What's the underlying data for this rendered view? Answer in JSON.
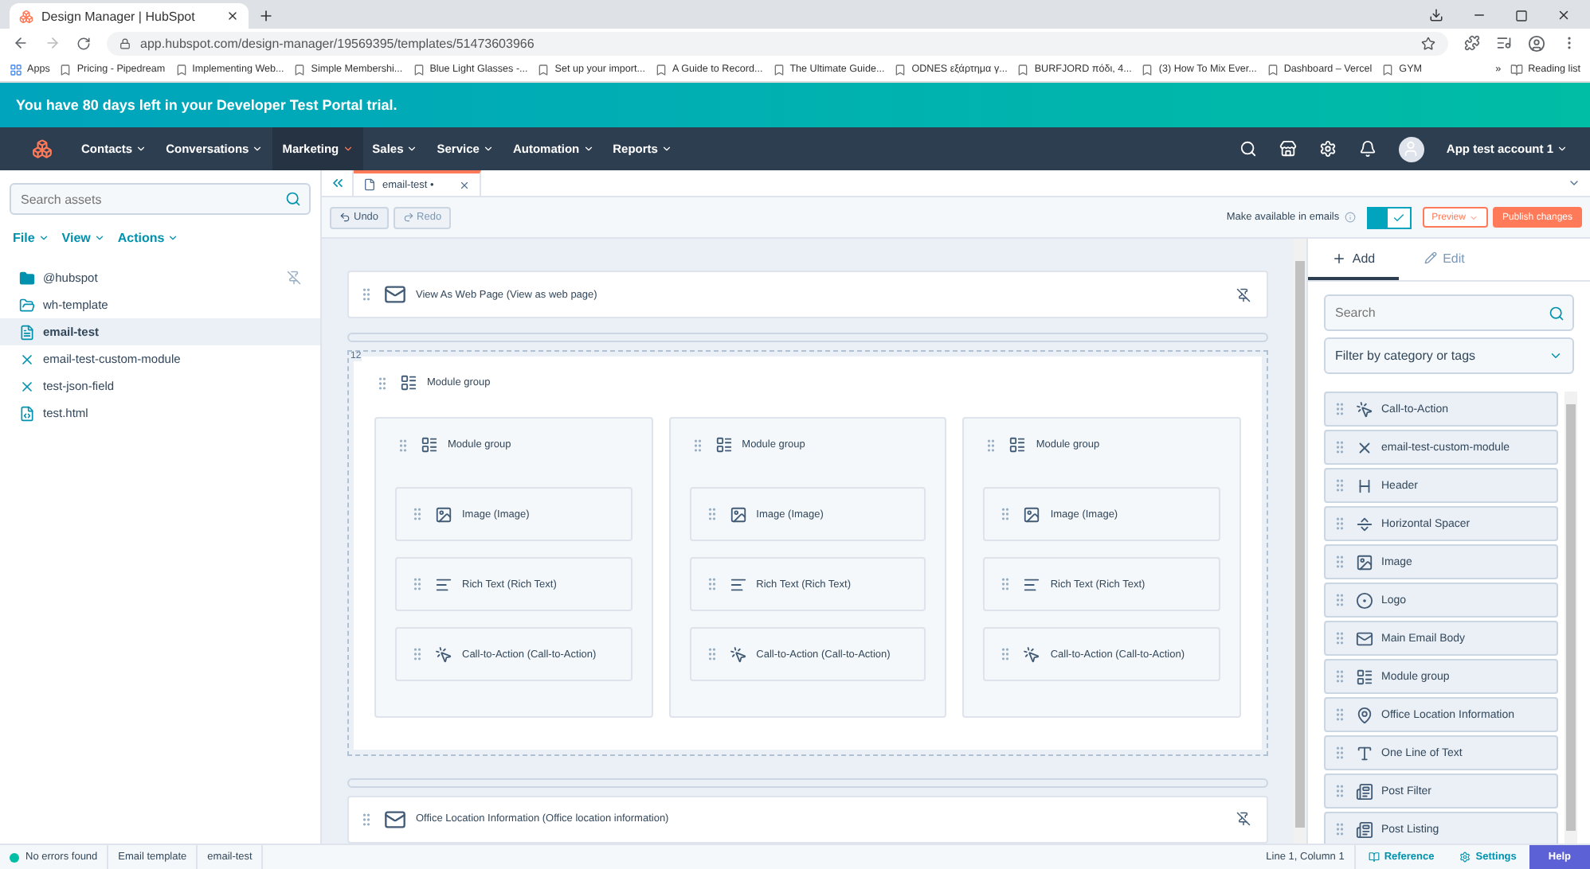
{
  "browser": {
    "tab_title": "Design Manager | HubSpot",
    "url": "app.hubspot.com/design-manager/19569395/templates/51473603966",
    "bookmarks": [
      "Apps",
      "Pricing - Pipedream",
      "Implementing Web...",
      "Simple Membershi...",
      "Blue Light Glasses -...",
      "Set up your import...",
      "A Guide to Record...",
      "The Ultimate Guide...",
      "ODNES εξάρτημα γ...",
      "BURFJORD πόδι, 4...",
      "(3) How To Mix Ever...",
      "Dashboard – Vercel",
      "GYM"
    ],
    "bookmarks_more": "»",
    "reading_list": "Reading list"
  },
  "banner": "You have 80 days left in your Developer Test Portal trial.",
  "nav": {
    "items": [
      {
        "label": "Contacts",
        "selected": false
      },
      {
        "label": "Conversations",
        "selected": false
      },
      {
        "label": "Marketing",
        "selected": true
      },
      {
        "label": "Sales",
        "selected": false
      },
      {
        "label": "Service",
        "selected": false
      },
      {
        "label": "Automation",
        "selected": false
      },
      {
        "label": "Reports",
        "selected": false
      }
    ],
    "account": "App test account 1"
  },
  "sidebar": {
    "search": {
      "placeholder": "Search assets"
    },
    "menus": [
      "File",
      "View",
      "Actions"
    ],
    "items": [
      {
        "kind": "folder",
        "label": "@hubspot",
        "selected": false,
        "pinned": true
      },
      {
        "kind": "template_folder",
        "label": "wh-template",
        "selected": false,
        "pinned": false
      },
      {
        "kind": "template",
        "label": "email-test",
        "selected": true,
        "pinned": false
      },
      {
        "kind": "module",
        "label": "email-test-custom-module",
        "selected": false,
        "pinned": false
      },
      {
        "kind": "module",
        "label": "test-json-field",
        "selected": false,
        "pinned": false
      },
      {
        "kind": "html",
        "label": "test.html",
        "selected": false,
        "pinned": false
      }
    ]
  },
  "editor_tab": {
    "label": "email-test",
    "unsaved_mark": "•"
  },
  "toolbar": {
    "undo": {
      "label": "Undo",
      "disabled": false
    },
    "redo": {
      "label": "Redo",
      "disabled": true
    },
    "available_label": "Make available in emails",
    "available_on": true,
    "preview": "Preview",
    "publish": "Publish changes"
  },
  "canvas": {
    "sections": [
      {
        "kind": "module",
        "label": "View As Web Page (View as web page)"
      },
      {
        "kind": "group",
        "number": "12",
        "label": "Module group",
        "columns": [
          {
            "label": "Module group",
            "modules": [
              {
                "kind": "image",
                "label": "Image (Image)"
              },
              {
                "kind": "rich_text",
                "label": "Rich Text (Rich Text)"
              },
              {
                "kind": "cta",
                "label": "Call-to-Action (Call-to-Action)"
              }
            ]
          },
          {
            "label": "Module group",
            "modules": [
              {
                "kind": "image",
                "label": "Image (Image)"
              },
              {
                "kind": "rich_text",
                "label": "Rich Text (Rich Text)"
              },
              {
                "kind": "cta",
                "label": "Call-to-Action (Call-to-Action)"
              }
            ]
          },
          {
            "label": "Module group",
            "modules": [
              {
                "kind": "image",
                "label": "Image (Image)"
              },
              {
                "kind": "rich_text",
                "label": "Rich Text (Rich Text)"
              },
              {
                "kind": "cta",
                "label": "Call-to-Action (Call-to-Action)"
              }
            ]
          }
        ]
      },
      {
        "kind": "module",
        "label": "Office Location Information (Office location information)"
      }
    ]
  },
  "panel": {
    "tabs": [
      {
        "label": "Add",
        "selected": true
      },
      {
        "label": "Edit",
        "selected": false
      }
    ],
    "search": {
      "placeholder": "Search"
    },
    "filter": "Filter by category or tags",
    "modules": [
      {
        "kind": "cta",
        "label": "Call-to-Action"
      },
      {
        "kind": "custom",
        "label": "email-test-custom-module"
      },
      {
        "kind": "header",
        "label": "Header"
      },
      {
        "kind": "spacer",
        "label": "Horizontal Spacer"
      },
      {
        "kind": "image",
        "label": "Image"
      },
      {
        "kind": "logo",
        "label": "Logo"
      },
      {
        "kind": "body",
        "label": "Main Email Body"
      },
      {
        "kind": "group",
        "label": "Module group"
      },
      {
        "kind": "office",
        "label": "Office Location Information"
      },
      {
        "kind": "text",
        "label": "One Line of Text"
      },
      {
        "kind": "post",
        "label": "Post Filter"
      },
      {
        "kind": "post",
        "label": "Post Listing"
      }
    ]
  },
  "status_bar": {
    "ok": true,
    "message": "No errors found",
    "type": "Email template",
    "file": "email-test",
    "position": "Line 1, Column 1",
    "reference": "Reference",
    "settings": "Settings",
    "help": "Help"
  }
}
